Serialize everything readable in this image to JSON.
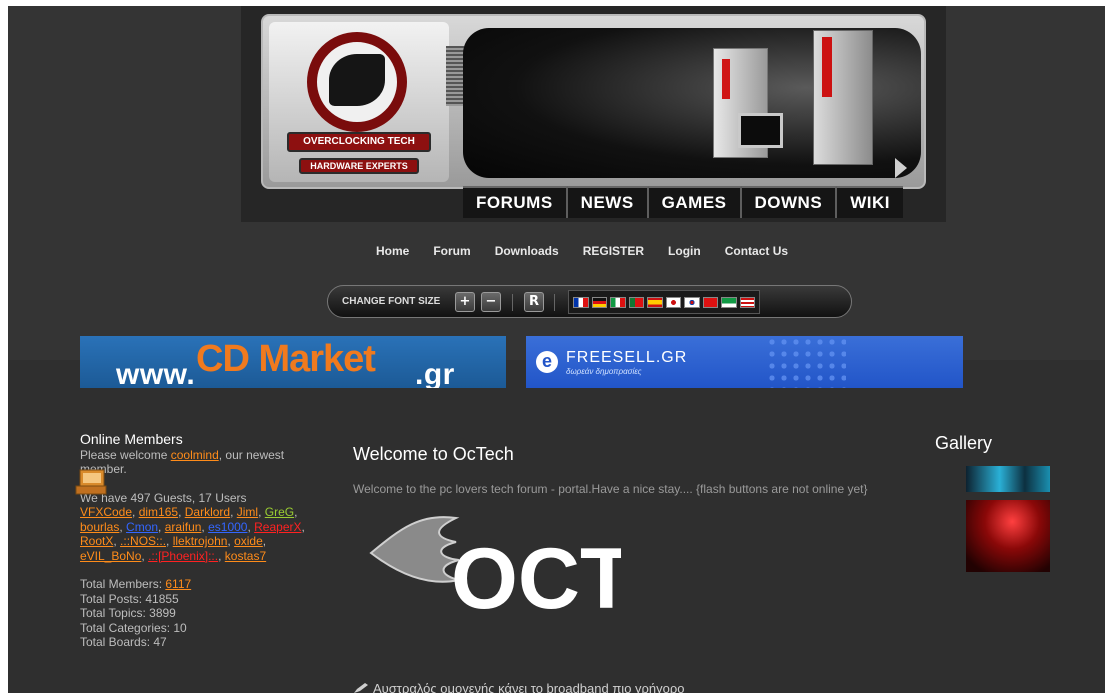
{
  "banner": {
    "logo_top_text": "OVERCLOCKING TECH",
    "logo_bottom_text": "HARDWARE EXPERTS",
    "nav": [
      "FORUMS",
      "NEWS",
      "GAMES",
      "DOWNS",
      "WIKI"
    ]
  },
  "top_links": [
    "Home",
    "Forum",
    "Downloads",
    "REGISTER",
    "Login",
    "Contact Us"
  ],
  "font_bar": {
    "label": "CHANGE FONT SIZE",
    "increase": "+",
    "decrease": "−",
    "reset": "R",
    "flag_icons": [
      "france-flag-icon",
      "germany-flag-icon",
      "italy-flag-icon",
      "portugal-flag-icon",
      "spain-flag-icon",
      "japan-flag-icon",
      "korea-flag-icon",
      "china-flag-icon",
      "arabic-flag-icon",
      "usa-flag-icon"
    ]
  },
  "ads": {
    "cd_market_www": "www.",
    "cd_market_domain": "CD Market",
    "cd_market_suffix": ".gr",
    "freesell_title": "FREESELL.GR",
    "freesell_sub": "δωρεάν δημοπρασίες"
  },
  "online_members": {
    "title": "Online Members",
    "welcome_prefix": "Please welcome ",
    "newest_member": "coolmind",
    "welcome_suffix": ", our newest member.",
    "guests_line": "We have 497 Guests, 17 Users",
    "users": [
      {
        "name": "VFXCode",
        "color": "#ff8c1a"
      },
      {
        "name": "dim165",
        "color": "#ff8c1a"
      },
      {
        "name": "Darklord",
        "color": "#ff8c1a"
      },
      {
        "name": "Jiml",
        "color": "#ff8c1a"
      },
      {
        "name": "GreG",
        "color": "#9acd32"
      },
      {
        "name": "bourlas",
        "color": "#ff8c1a"
      },
      {
        "name": "Cmon",
        "color": "#3366ff"
      },
      {
        "name": "araifun",
        "color": "#ff8c1a"
      },
      {
        "name": "es1000",
        "color": "#3366ff"
      },
      {
        "name": "ReaperX",
        "color": "#ff2222"
      },
      {
        "name": "RootX",
        "color": "#ff8c1a"
      },
      {
        "name": ".::NOS::.",
        "color": "#ff8c1a"
      },
      {
        "name": "llektrojohn",
        "color": "#ff8c1a"
      },
      {
        "name": "oxide",
        "color": "#ff8c1a"
      },
      {
        "name": "eVIL_BoNo",
        "color": "#ff8c1a"
      },
      {
        "name": ".::[Phoenix]::.",
        "color": "#ff2222"
      },
      {
        "name": "kostas7",
        "color": "#ff8c1a"
      }
    ],
    "total_members_label": "Total Members: ",
    "total_members_value": "6117",
    "total_posts": "Total Posts: 41855",
    "total_topics": "Total Topics: 3899",
    "total_categories": "Total Categories: 10",
    "total_boards": "Total Boards: 47"
  },
  "main": {
    "title": "Welcome to OcTech",
    "text": "Welcome to the pc lovers tech forum - portal.Have a nice stay.... {flash buttons are not online yet}",
    "logo_text": "OCT",
    "news_line": "Αυστραλός ομογενής κάνει το broadband πιο γρήγορο"
  },
  "gallery": {
    "title": "Gallery"
  }
}
